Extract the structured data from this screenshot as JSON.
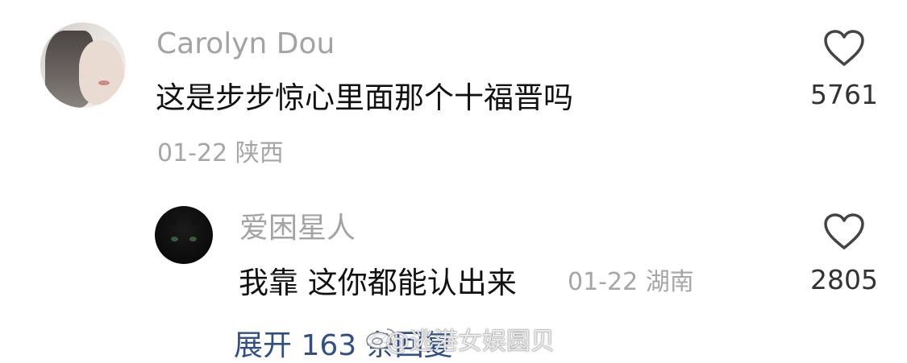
{
  "comment": {
    "username": "Carolyn Dou",
    "text": "这是步步惊心里面那个十福晋吗",
    "date": "01-22",
    "location": "陕西",
    "likes": "5761",
    "like_icon": "heart-outline-icon"
  },
  "reply": {
    "username": "爱困星人",
    "text": "我靠 这你都能认出来",
    "date": "01-22",
    "location": "湖南",
    "likes": "2805",
    "like_icon": "heart-outline-icon"
  },
  "expand_replies": {
    "label": "展开 163 条回复"
  },
  "watermark": {
    "text": "@逃港女娱圆贝",
    "icon": "weibo-icon"
  },
  "colors": {
    "username": "#a3a3a3",
    "text": "#111111",
    "meta": "#a6a6a6",
    "link": "#2f4f86"
  }
}
